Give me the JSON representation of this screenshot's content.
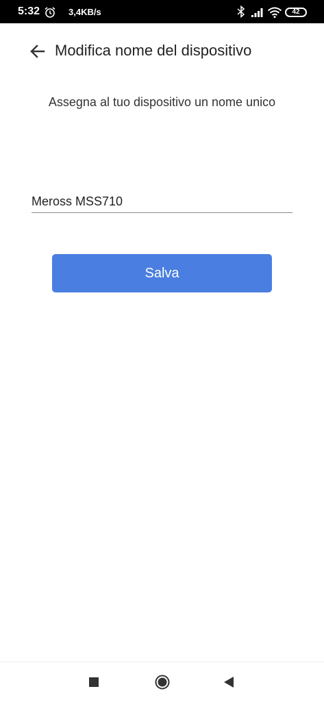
{
  "status_bar": {
    "time": "5:32",
    "speed": "3,4KB/s",
    "battery": "42",
    "icons": [
      "alarm-icon",
      "bluetooth-icon",
      "signal-icon",
      "wifi-icon",
      "battery-icon"
    ]
  },
  "header": {
    "title": "Modifica nome del dispositivo",
    "back_icon": "arrow-left-icon"
  },
  "main": {
    "subtitle": "Assegna al tuo dispositivo un nome unico",
    "device_name_value": "Meross MSS710",
    "save_label": "Salva"
  },
  "nav_bar": {
    "icons": [
      "recents-square-icon",
      "home-circle-icon",
      "back-triangle-icon"
    ]
  },
  "colors": {
    "accent": "#4a7ee0",
    "status_bar_bg": "#000000",
    "background": "#ffffff"
  }
}
